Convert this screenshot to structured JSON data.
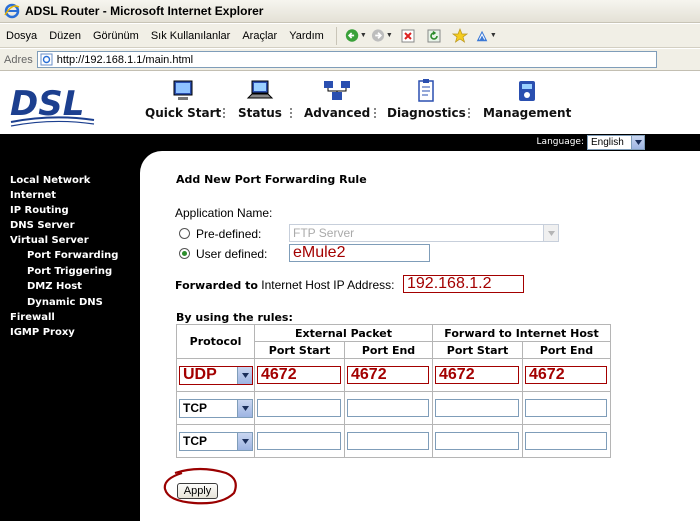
{
  "window": {
    "title": "ADSL Router - Microsoft Internet Explorer"
  },
  "menu": {
    "items": [
      "Dosya",
      "Düzen",
      "Görünüm",
      "Sık Kullanılanlar",
      "Araçlar",
      "Yardım"
    ]
  },
  "address": {
    "label": "Adres",
    "url": "http://192.168.1.1/main.html"
  },
  "logo": {
    "text": "DSL"
  },
  "nav": {
    "items": [
      "Quick Start",
      "Status",
      "Advanced",
      "Diagnostics",
      "Management"
    ]
  },
  "language": {
    "label": "Language:",
    "value": "English"
  },
  "sidebar": {
    "items": [
      "Local Network",
      "Internet",
      "IP Routing",
      "DNS Server",
      "Virtual Server",
      "Port Forwarding",
      "Port Triggering",
      "DMZ Host",
      "Dynamic DNS",
      "Firewall",
      "IGMP Proxy"
    ]
  },
  "form": {
    "heading": "Add New Port Forwarding Rule",
    "app_name_label": "Application Name:",
    "predefined_label": "Pre-defined:",
    "predefined_value": "FTP Server",
    "userdefined_label": "User defined:",
    "userdefined_value": "eMule2",
    "forwarded_bold": "Forwarded to",
    "forwarded_rest": "Internet Host IP Address:",
    "ip_value": "192.168.1.2",
    "rules_label": "By using the rules:",
    "table": {
      "protocol_header": "Protocol",
      "external_header": "External Packet",
      "forward_header": "Forward to Internet Host",
      "port_start": "Port Start",
      "port_end": "Port End",
      "rows": [
        {
          "protocol": "UDP",
          "ext_start": "4672",
          "ext_end": "4672",
          "fwd_start": "4672",
          "fwd_end": "4672"
        },
        {
          "protocol": "TCP",
          "ext_start": "",
          "ext_end": "",
          "fwd_start": "",
          "fwd_end": ""
        },
        {
          "protocol": "TCP",
          "ext_start": "",
          "ext_end": "",
          "fwd_start": "",
          "fwd_end": ""
        }
      ]
    },
    "apply_label": "Apply"
  },
  "colors": {
    "accent_red": "#a30000",
    "logo_blue": "#1c3f8f",
    "sidebar_bg": "#000000"
  }
}
